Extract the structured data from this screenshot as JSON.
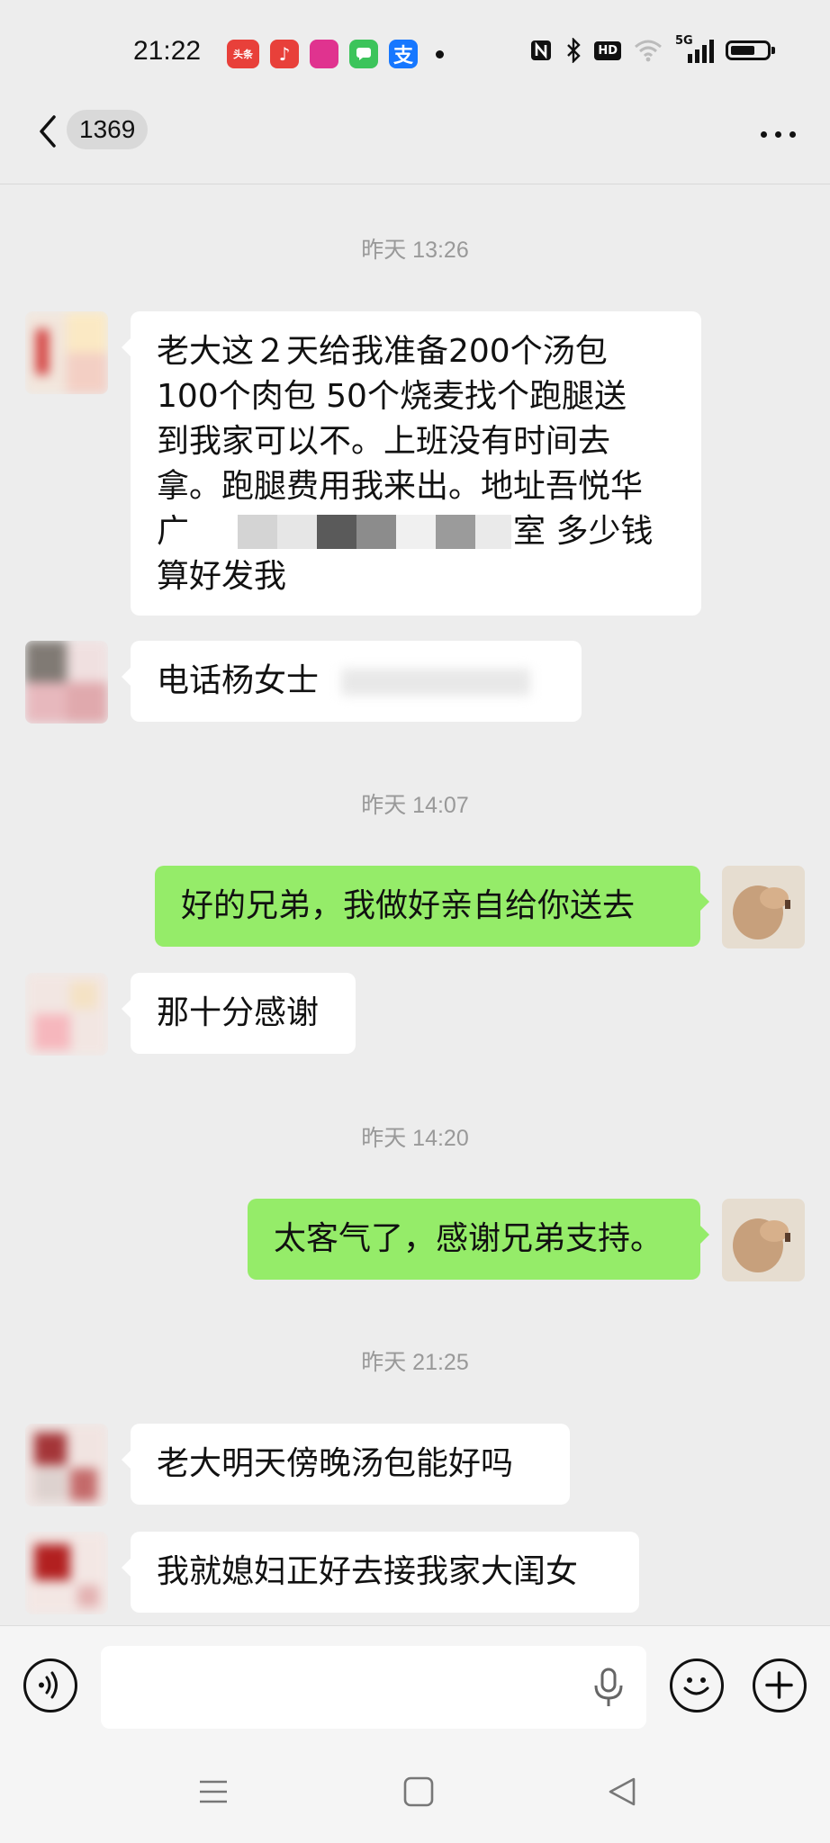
{
  "status_bar": {
    "time": "21:22",
    "app_icons": [
      {
        "name": "toutiao-icon",
        "label": "头条",
        "color": "#e8403a"
      },
      {
        "name": "music-icon",
        "label": "♪",
        "color": "#e8403a"
      },
      {
        "name": "shop-icon",
        "label": "",
        "color": "#e0338f"
      },
      {
        "name": "messages-icon",
        "label": "",
        "color": "#3cc45b"
      },
      {
        "name": "alipay-icon",
        "label": "支",
        "color": "#1677ff"
      }
    ],
    "network": "5G",
    "hd": "HD",
    "battery_level": 0.6
  },
  "nav": {
    "unread_count": "1369"
  },
  "messages": [
    {
      "type": "time",
      "text": "昨天 13:26"
    },
    {
      "type": "left",
      "lines": [
        "老大这２天给我准备200个汤包",
        "100个肉包 50个烧麦找个跑腿送",
        "到我家可以不。上班没有时间去",
        "拿。跑腿费用我来出。地址吾悦华",
        "广",
        "算好发我"
      ],
      "redacted_tail": "室  多少钱"
    },
    {
      "type": "left",
      "text": "电话杨女士"
    },
    {
      "type": "time",
      "text": "昨天 14:07"
    },
    {
      "type": "right",
      "text": "好的兄弟，我做好亲自给你送去"
    },
    {
      "type": "left",
      "text": "那十分感谢"
    },
    {
      "type": "time",
      "text": "昨天 14:20"
    },
    {
      "type": "right",
      "text": "太客气了，感谢兄弟支持。"
    },
    {
      "type": "time",
      "text": "昨天 21:25"
    },
    {
      "type": "left",
      "text": "老大明天傍晚汤包能好吗"
    },
    {
      "type": "left",
      "text": "我就媳妇正好去接我家大闺女"
    }
  ],
  "colors": {
    "background": "#ededed",
    "self_bubble": "#95ec69",
    "other_bubble": "#ffffff"
  }
}
